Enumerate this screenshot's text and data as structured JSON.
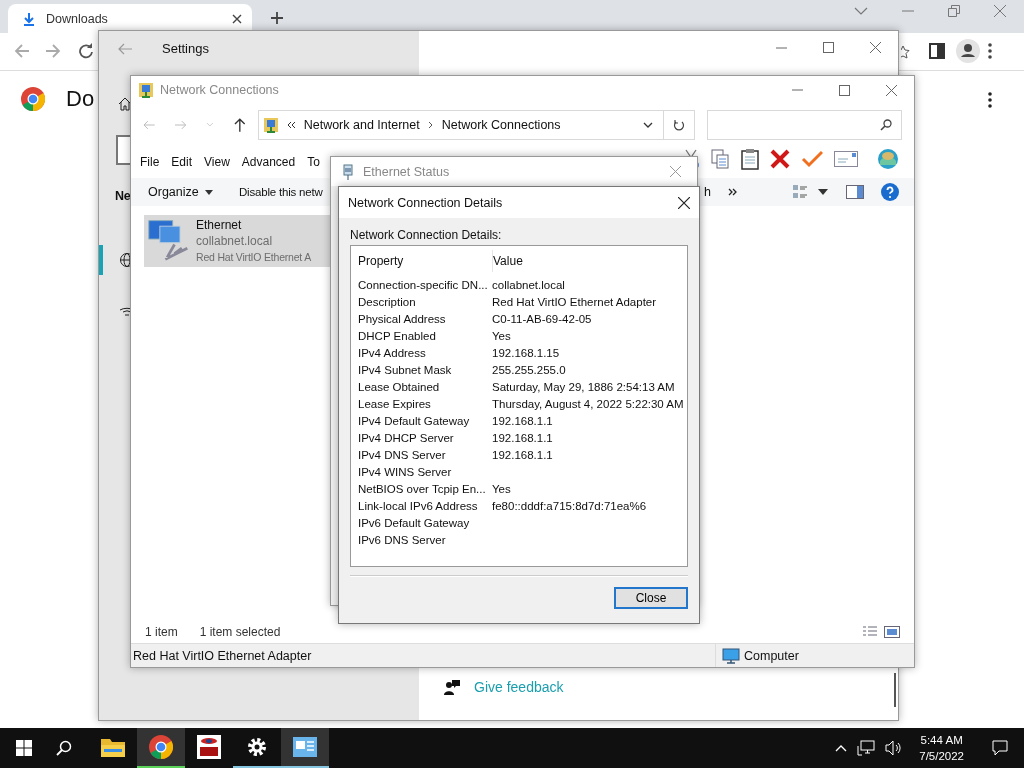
{
  "browser": {
    "tab": {
      "title": "Downloads",
      "selected": true
    },
    "page_title": "Do"
  },
  "settings": {
    "title": "Settings",
    "nav_heading": "Ne",
    "nav_items": [
      {
        "kind": "globe",
        "selected": true
      },
      {
        "kind": "dialup",
        "selected": false
      }
    ],
    "feedback": "Give feedback"
  },
  "network_connections": {
    "title": "Network Connections",
    "breadcrumb": [
      "Network and Internet",
      "Network Connections"
    ],
    "menu": [
      "File",
      "Edit",
      "View",
      "Advanced",
      "To"
    ],
    "commands": [
      "Organize",
      "Disable this netw"
    ],
    "more_command": "h",
    "item": {
      "name": "Ethernet",
      "network": "collabnet.local",
      "adapter": "Red Hat VirtIO Ethernet A",
      "selected": true
    },
    "status": {
      "count": "1 item",
      "selection": "1 item selected"
    },
    "status_bar": {
      "description": "Red Hat VirtIO Ethernet Adapter",
      "zone": "Computer"
    }
  },
  "ethernet_status": {
    "title": "Ethernet Status"
  },
  "details_dialog": {
    "title": "Network Connection Details",
    "label": "Network Connection Details:",
    "columns": [
      "Property",
      "Value"
    ],
    "rows": [
      {
        "property": "Connection-specific DN...",
        "value": "collabnet.local"
      },
      {
        "property": "Description",
        "value": "Red Hat VirtIO Ethernet Adapter"
      },
      {
        "property": "Physical Address",
        "value": "C0-11-AB-69-42-05"
      },
      {
        "property": "DHCP Enabled",
        "value": "Yes"
      },
      {
        "property": "IPv4 Address",
        "value": "192.168.1.15"
      },
      {
        "property": "IPv4 Subnet Mask",
        "value": "255.255.255.0"
      },
      {
        "property": "Lease Obtained",
        "value": "Saturday, May 29, 1886 2:54:13 AM"
      },
      {
        "property": "Lease Expires",
        "value": "Thursday, August 4, 2022 5:22:30 AM"
      },
      {
        "property": "IPv4 Default Gateway",
        "value": "192.168.1.1"
      },
      {
        "property": "IPv4 DHCP Server",
        "value": "192.168.1.1"
      },
      {
        "property": "IPv4 DNS Server",
        "value": "192.168.1.1"
      },
      {
        "property": "IPv4 WINS Server"
      },
      {
        "property": "NetBIOS over Tcpip En...",
        "value": "Yes"
      },
      {
        "property": "Link-local IPv6 Address",
        "value": "fe80::dddf:a715:8d7d:71ea%6"
      },
      {
        "property": "IPv6 Default Gateway"
      },
      {
        "property": "IPv6 DNS Server"
      }
    ],
    "button": "Close"
  },
  "taskbar": {
    "apps": [
      {
        "kind": "explorer",
        "running": false,
        "active": false
      },
      {
        "kind": "chrome",
        "running": true,
        "active": true
      },
      {
        "kind": "vnc",
        "running": false,
        "active": false
      },
      {
        "kind": "settings",
        "running": true,
        "active": false
      },
      {
        "kind": "network",
        "running": true,
        "active": true
      }
    ],
    "time": "5:44 AM",
    "date": "7/5/2022"
  }
}
